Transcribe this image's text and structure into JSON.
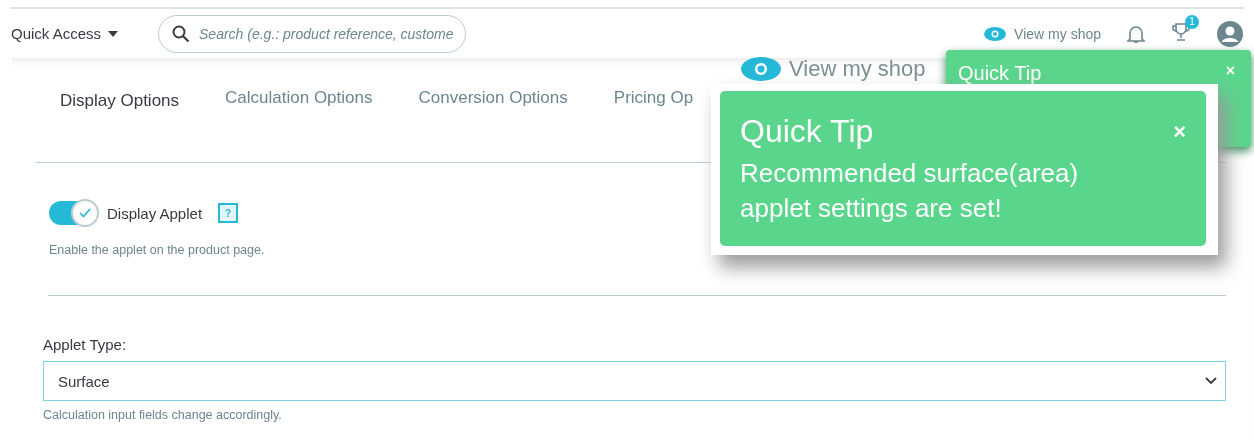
{
  "header": {
    "quick_access": "Quick Access",
    "search": {
      "placeholder": "Search (e.g.: product reference, custome"
    },
    "view_shop": "View my shop",
    "badge": "1"
  },
  "tabs": [
    {
      "label": "Display Options",
      "selected": true
    },
    {
      "label": "Calculation Options",
      "selected": false
    },
    {
      "label": "Conversion Options",
      "selected": false
    },
    {
      "label": "Pricing Op",
      "selected": false
    }
  ],
  "display_applet": {
    "label": "Display Applet",
    "on": true,
    "help": "?",
    "description": "Enable the applet on the product page."
  },
  "applet_type": {
    "label": "Applet Type:",
    "value": "Surface",
    "hint": "Calculation input fields change accordingly."
  },
  "toast": {
    "title": "Quick Tip",
    "close": "×"
  },
  "zoom_inset": {
    "view_shop": "View my shop",
    "toast": {
      "title": "Quick Tip",
      "close": "×",
      "message": "Recommended surface(area) applet settings are set!"
    }
  }
}
